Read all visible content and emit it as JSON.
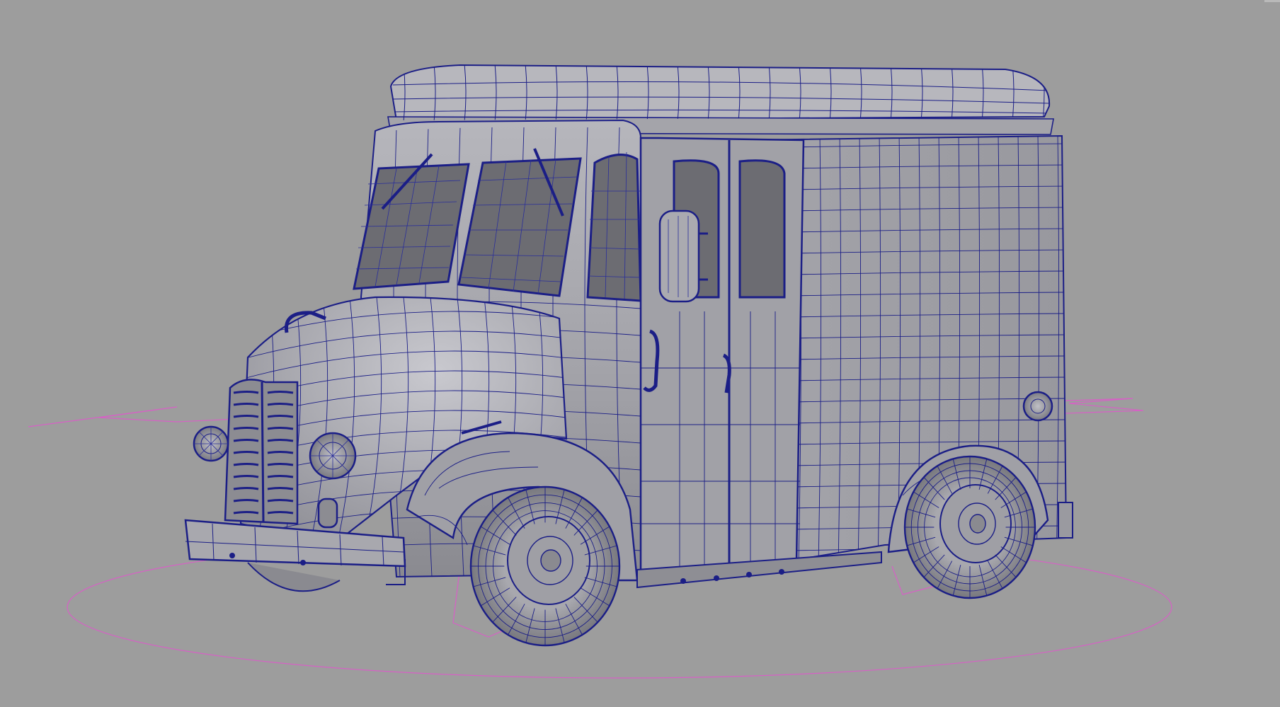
{
  "app": {
    "view": "3d-viewport",
    "mode": "wireframe-on-shaded",
    "object": "delivery-van",
    "selection": "none"
  },
  "colors": {
    "background": "#9d9d9d",
    "mesh_fill": "#a3a3a9",
    "mesh_shadow": "#7d7d85",
    "mesh_highlight": "#c4c4ca",
    "wire": "#1b1e86",
    "wire_light": "#3a3fae",
    "glass": "#6c6c72",
    "curve": "#d760c6",
    "tire": "#8d8d93",
    "hub": "#9f9fa5"
  },
  "icons": {
    "viewport_corner": "viewport-corner-icon"
  }
}
